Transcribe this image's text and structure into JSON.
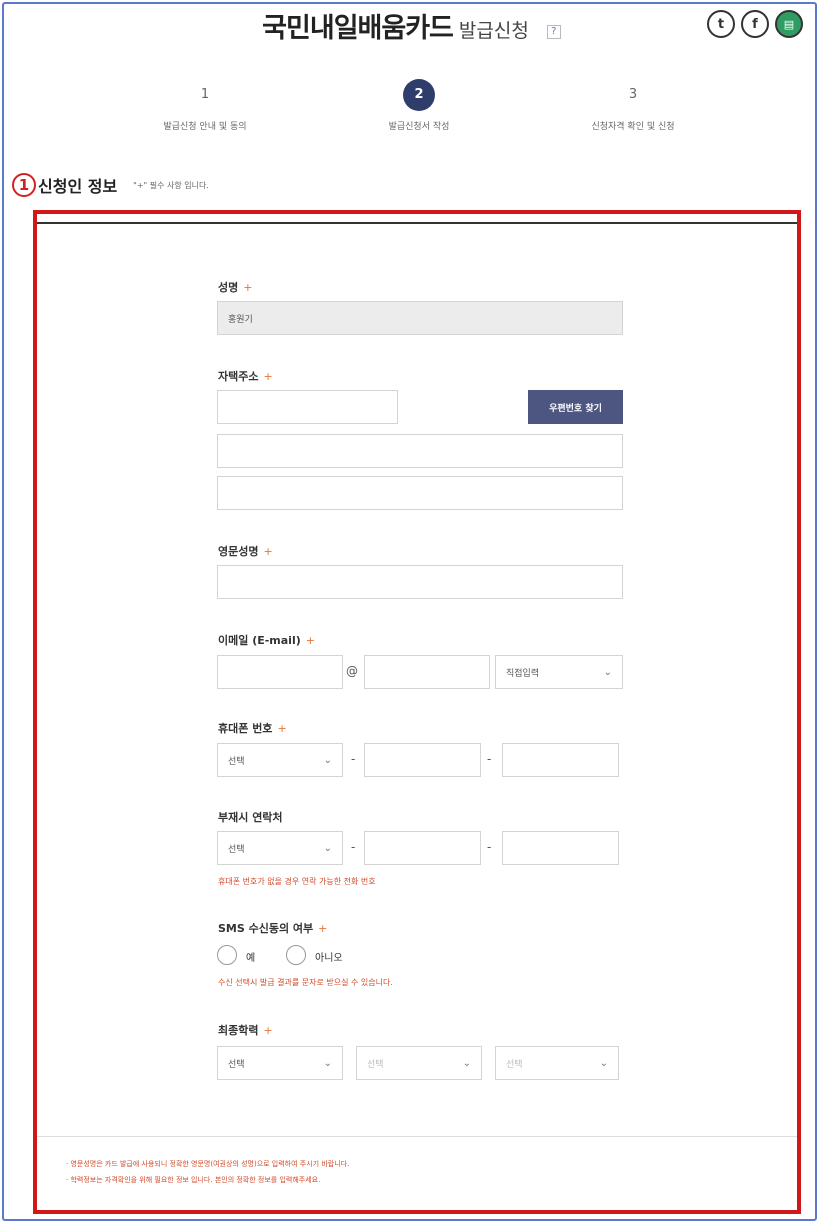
{
  "header": {
    "title": "국민내일배움카드",
    "subtitle": "발급신청",
    "help": "?"
  },
  "share": {
    "twitter": "t",
    "facebook": "f",
    "print": "▤"
  },
  "steps": [
    {
      "num": "1",
      "label": "발급신청 안내 및 동의"
    },
    {
      "num": "2",
      "label": "발급신청서 작성"
    },
    {
      "num": "3",
      "label": "신청자격 확인 및 신청"
    }
  ],
  "section": {
    "marker": "1",
    "title": "신청인 정보",
    "note": "\"+\" 필수 사항 입니다."
  },
  "required_mark": "+",
  "form": {
    "name": {
      "label": "성명",
      "value": "홍원기"
    },
    "address": {
      "label": "자택주소",
      "zip_button": "우편번호 찾기"
    },
    "english_name": {
      "label": "영문성명"
    },
    "email": {
      "label": "이메일 (E-mail)",
      "at": "@",
      "domain_select": "직접입력"
    },
    "mobile": {
      "label": "휴대폰 번호",
      "select": "선택",
      "dash": "-"
    },
    "alt_contact": {
      "label": "부재시 연락처",
      "select": "선택",
      "dash": "-",
      "hint": "휴대폰 번호가 없을 경우 연락 가능한 전화 번호"
    },
    "sms": {
      "label": "SMS 수신동의 여부",
      "yes": "예",
      "no": "아니오",
      "hint": "수신 선택시 발급 결과를 문자로 받으실 수 있습니다."
    },
    "education": {
      "label": "최종학력",
      "select1": "선택",
      "select2": "선택",
      "select3": "선택"
    }
  },
  "footnotes": [
    "· 영문성명은 카드 발급에 사용되니 정확한 영문명(여권상의 성명)으로 입력하여 주시기 바랍니다.",
    "· 학력정보는 자격확인을 위해 필요한 정보 입니다. 본인의 정확한 정보를 입력해주세요."
  ]
}
